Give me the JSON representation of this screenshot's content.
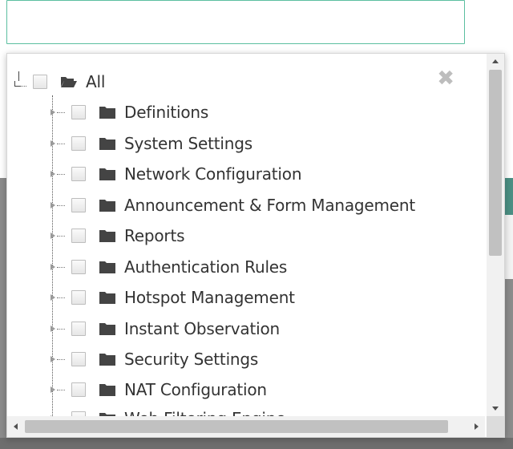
{
  "search": {
    "value": "",
    "placeholder": ""
  },
  "dropdown": {
    "close_icon": "close-icon",
    "root": {
      "label": "All",
      "icon": "folder-open-icon"
    },
    "items": [
      {
        "label": "Definitions"
      },
      {
        "label": "System Settings"
      },
      {
        "label": "Network Configuration"
      },
      {
        "label": "Announcement & Form Management"
      },
      {
        "label": "Reports"
      },
      {
        "label": "Authentication Rules"
      },
      {
        "label": "Hotspot Management"
      },
      {
        "label": "Instant Observation"
      },
      {
        "label": "Security Settings"
      },
      {
        "label": "NAT Configuration"
      },
      {
        "label": "Web Filtering Engine"
      }
    ]
  },
  "colors": {
    "input_border": "#5bbfa0",
    "folder_icon": "#444444",
    "label_text": "#333333",
    "close_icon": "#bdbdbd"
  }
}
